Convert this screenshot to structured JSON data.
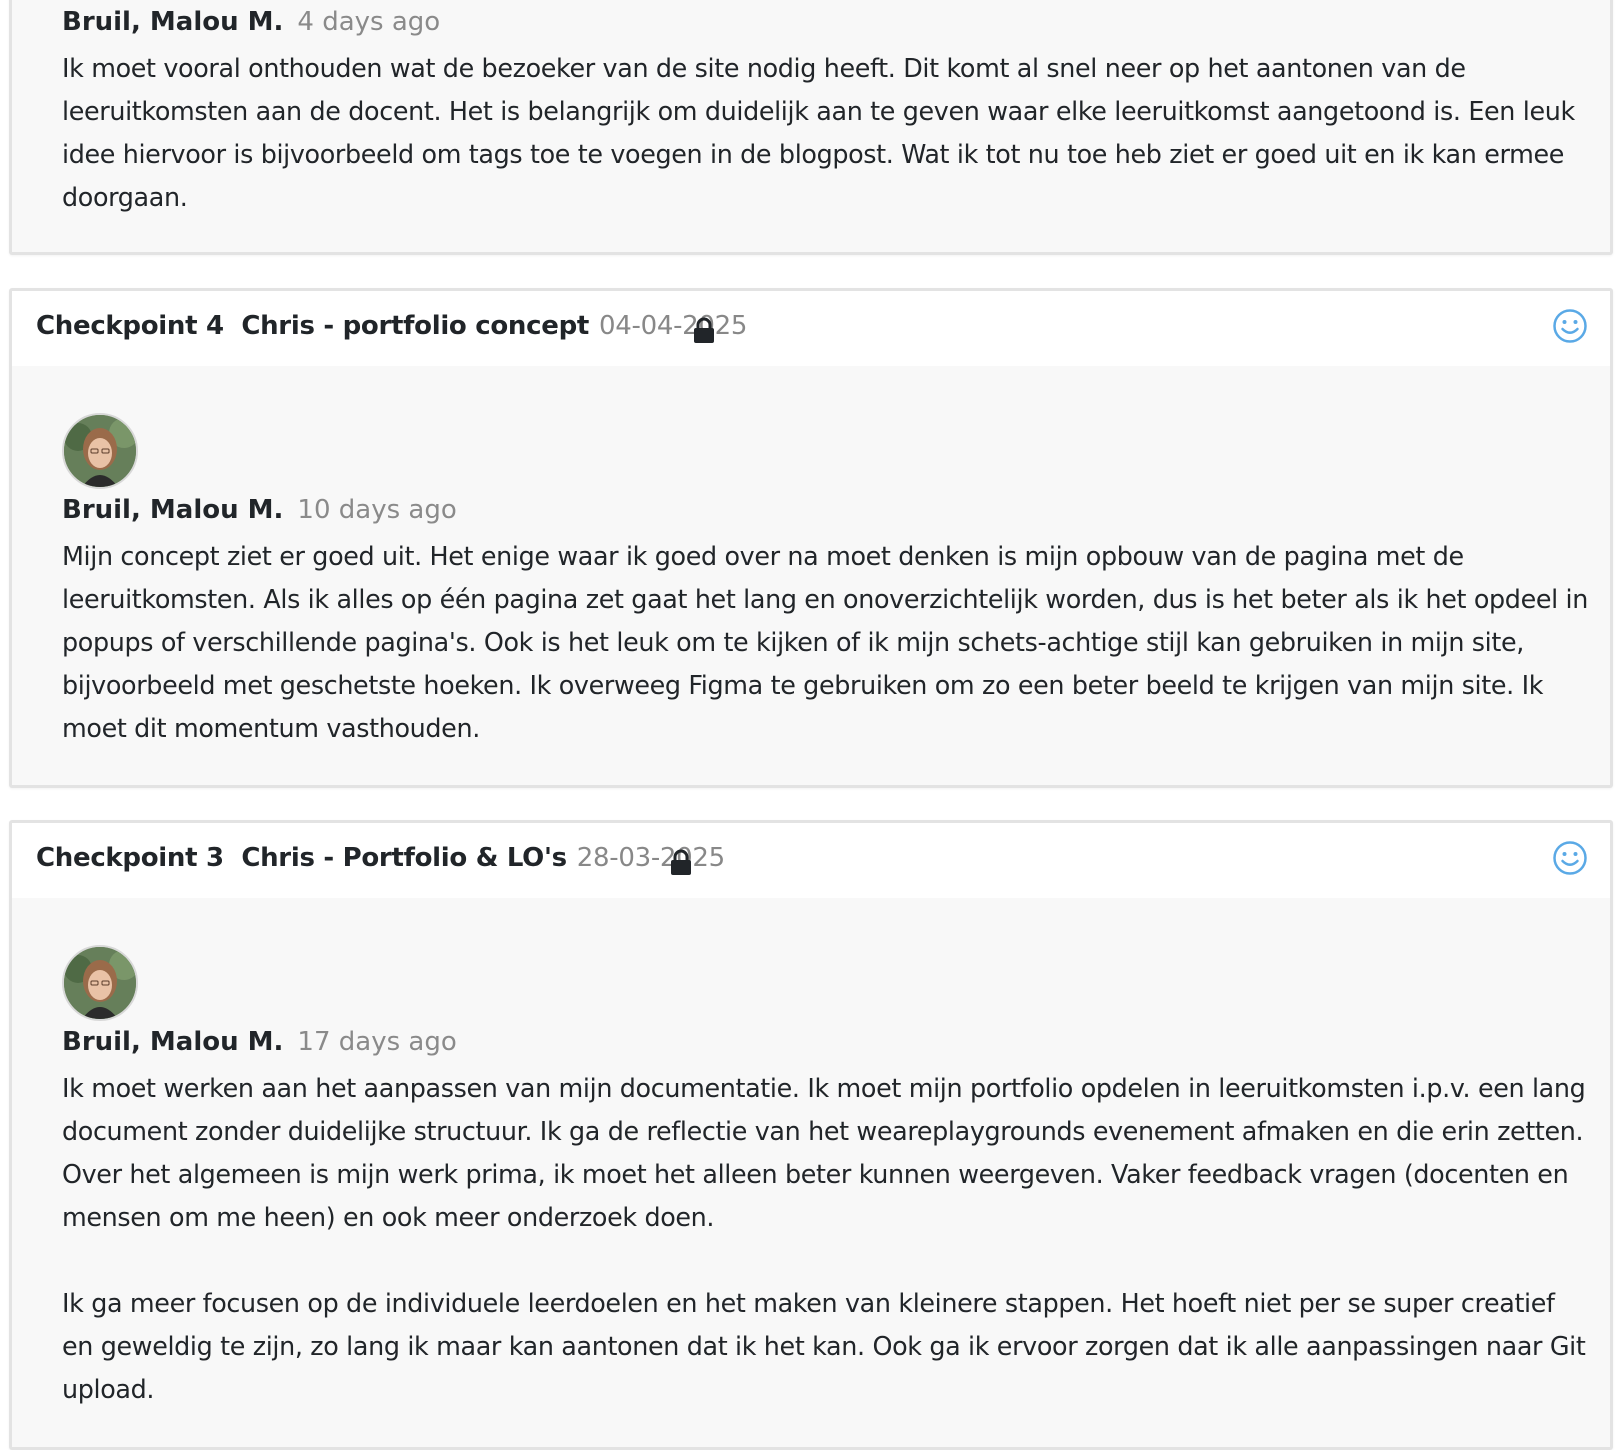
{
  "entries": [
    {
      "author": "Bruil, Malou M.",
      "time_ago": "4 days ago",
      "text": "Ik moet vooral onthouden wat de bezoeker van de site nodig heeft. Dit komt al snel neer op het aantonen van de leeruitkomsten aan de docent. Het is belangrijk om duidelijk aan te geven waar elke leeruitkomst aangetoond is. Een leuk idee hiervoor is bijvoorbeeld om tags toe te voegen in de blogpost. Wat ik tot nu toe heb ziet er goed uit en ik kan ermee doorgaan."
    },
    {
      "checkpoint": "Checkpoint 4",
      "title": "Chris - portfolio concept",
      "date": "04-04-2025",
      "author": "Bruil, Malou M.",
      "time_ago": "10 days ago",
      "text": "Mijn concept ziet er goed uit. Het enige waar ik goed over na moet denken is mijn opbouw van de pagina met de leeruitkomsten. Als ik alles op één pagina zet gaat het lang en onoverzichtelijk worden, dus is het beter als ik het opdeel in popups of verschillende pagina's. Ook is het leuk om te kijken of ik mijn schets-achtige stijl kan gebruiken in mijn site, bijvoorbeeld met geschetste hoeken. Ik overweeg Figma te gebruiken om zo een beter beeld te krijgen van mijn site. Ik moet dit momentum vasthouden."
    },
    {
      "checkpoint": "Checkpoint 3",
      "title": "Chris - Portfolio & LO's",
      "date": "28-03-2025",
      "author": "Bruil, Malou M.",
      "time_ago": "17 days ago",
      "text": "Ik moet werken aan het aanpassen van mijn documentatie. Ik moet mijn portfolio opdelen in leeruitkomsten i.p.v. een lang document zonder duidelijke structuur. Ik ga de reflectie van het weareplaygrounds evenement afmaken en die erin zetten. Over het algemeen is mijn werk prima, ik moet het alleen beter kunnen weergeven. Vaker feedback vragen (docenten en mensen om me heen) en ook meer onderzoek doen.",
      "text2": "Ik ga meer focusen op de individuele leerdoelen en het maken van kleinere stappen. Het hoeft niet per se super creatief en geweldig te zijn, zo lang ik maar kan aantonen dat ik het kan. Ook ga ik ervoor zorgen dat ik alle aanpassingen naar Git upload."
    }
  ],
  "icons": {
    "lock": "lock-icon",
    "feedback": "smiley-icon"
  },
  "colors": {
    "accent": "#5aa9e6",
    "muted": "#888888",
    "card_bg": "#f8f8f8"
  }
}
